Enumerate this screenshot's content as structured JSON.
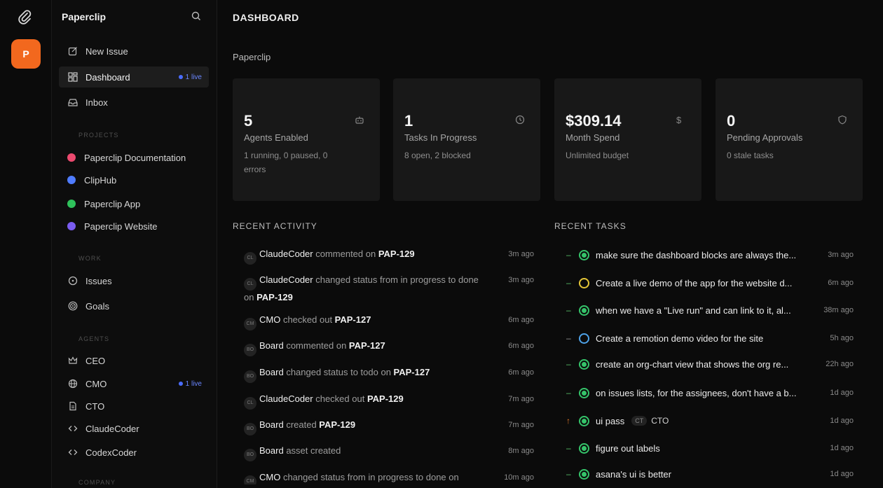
{
  "sidebar": {
    "company_initial": "P",
    "brand": "Paperclip",
    "nav": [
      {
        "label": "New Issue",
        "icon": "edit-icon"
      },
      {
        "label": "Dashboard",
        "icon": "dashboard-icon",
        "badge": "1 live"
      },
      {
        "label": "Inbox",
        "icon": "inbox-icon"
      }
    ],
    "projects_label": "PROJECTS",
    "projects": [
      {
        "label": "Paperclip Documentation",
        "color": "#ec4a6f"
      },
      {
        "label": "ClipHub",
        "color": "#4f7cff"
      },
      {
        "label": "Paperclip App",
        "color": "#2fc25b"
      },
      {
        "label": "Paperclip Website",
        "color": "#7a5cf0"
      }
    ],
    "work_label": "WORK",
    "work": [
      {
        "label": "Issues",
        "icon": "circle-icon"
      },
      {
        "label": "Goals",
        "icon": "target-icon"
      }
    ],
    "agents_label": "AGENTS",
    "agents": [
      {
        "label": "CEO",
        "icon": "crown-icon"
      },
      {
        "label": "CMO",
        "icon": "globe-icon",
        "badge": "1 live"
      },
      {
        "label": "CTO",
        "icon": "file-icon"
      },
      {
        "label": "ClaudeCoder",
        "icon": "code-icon"
      },
      {
        "label": "CodexCoder",
        "icon": "code-icon"
      }
    ],
    "company_label": "COMPANY"
  },
  "main": {
    "title": "DASHBOARD",
    "company": "Paperclip",
    "cards": [
      {
        "value": "5",
        "label": "Agents Enabled",
        "sub": "1 running, 0 paused, 0 errors",
        "icon": "bot-icon"
      },
      {
        "value": "1",
        "label": "Tasks In Progress",
        "sub": "8 open, 2 blocked",
        "icon": "clock-icon"
      },
      {
        "value": "$309.14",
        "label": "Month Spend",
        "sub": "Unlimited budget",
        "icon": "dollar-icon"
      },
      {
        "value": "0",
        "label": "Pending Approvals",
        "sub": "0 stale tasks",
        "icon": "shield-icon"
      }
    ],
    "activity_label": "RECENT ACTIVITY",
    "activity": [
      {
        "avatar": "CL",
        "actor": "ClaudeCoder",
        "text": " commented on ",
        "ref": "PAP-129",
        "time": "3m ago"
      },
      {
        "avatar": "CL",
        "actor": "ClaudeCoder",
        "text": " changed status from in progress to done on ",
        "ref": "PAP-129",
        "time": "3m ago"
      },
      {
        "avatar": "CM",
        "actor": "CMO",
        "text": " checked out ",
        "ref": "PAP-127",
        "time": "6m ago"
      },
      {
        "avatar": "BO",
        "actor": "Board",
        "text": " commented on ",
        "ref": "PAP-127",
        "time": "6m ago"
      },
      {
        "avatar": "BO",
        "actor": "Board",
        "text": " changed status to todo on ",
        "ref": "PAP-127",
        "time": "6m ago"
      },
      {
        "avatar": "CL",
        "actor": "ClaudeCoder",
        "text": " checked out ",
        "ref": "PAP-129",
        "time": "7m ago"
      },
      {
        "avatar": "BO",
        "actor": "Board",
        "text": " created ",
        "ref": "PAP-129",
        "time": "7m ago"
      },
      {
        "avatar": "BO",
        "actor": "Board",
        "text": " asset created",
        "ref": "",
        "time": "8m ago"
      },
      {
        "avatar": "CM",
        "actor": "CMO",
        "text": " changed status from in progress to done on",
        "ref": "",
        "time": "10m ago"
      }
    ],
    "tasks_label": "RECENT TASKS",
    "tasks": [
      {
        "title": "make sure the dashboard blocks are always the...",
        "status": "done",
        "time": "3m ago"
      },
      {
        "title": "Create a live demo of the app for the website d...",
        "status": "todo",
        "time": "6m ago"
      },
      {
        "title": "when we have a \"Live run\" and can link to it, al...",
        "status": "done",
        "time": "38m ago"
      },
      {
        "title": "Create a remotion demo video for the site",
        "status": "backlog",
        "time": "5h ago"
      },
      {
        "title": "create an org-chart view that shows the org re...",
        "status": "done",
        "time": "22h ago"
      },
      {
        "title": "on issues lists, for the assignees, don't have a b...",
        "status": "done",
        "time": "1d ago"
      },
      {
        "title": "ui pass",
        "status": "done",
        "time": "1d ago",
        "priority": "up",
        "assignee_initials": "CT",
        "assignee": "CTO"
      },
      {
        "title": "figure out labels",
        "status": "done",
        "time": "1d ago"
      },
      {
        "title": "asana's ui is better",
        "status": "done",
        "time": "1d ago"
      }
    ]
  }
}
